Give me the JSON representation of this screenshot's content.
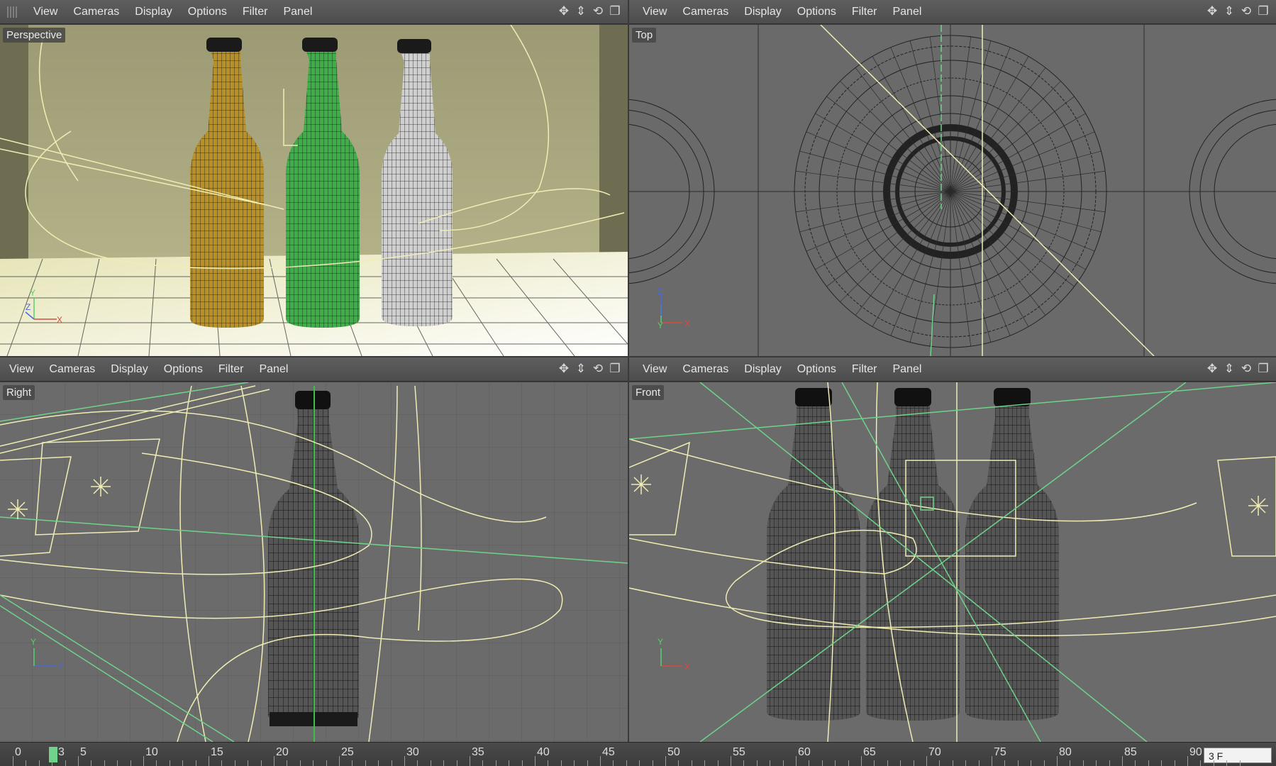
{
  "menu": [
    "View",
    "Cameras",
    "Display",
    "Options",
    "Filter",
    "Panel"
  ],
  "viewports": {
    "perspective": {
      "label": "Perspective"
    },
    "top": {
      "label": "Top"
    },
    "right": {
      "label": "Right"
    },
    "front": {
      "label": "Front"
    }
  },
  "nav_icons": [
    "move-view-icon",
    "zoom-view-icon",
    "rotate-view-icon",
    "maximize-view-icon"
  ],
  "axis": {
    "x": "X",
    "y": "Y",
    "z": "Z"
  },
  "timeline": {
    "ticks": [
      "0",
      "5",
      "10",
      "15",
      "20",
      "25",
      "30",
      "35",
      "40",
      "45",
      "50",
      "55",
      "60",
      "65",
      "70",
      "75",
      "80",
      "85",
      "90"
    ],
    "current_frame": "3",
    "frame_field": "3 F"
  },
  "colors": {
    "spline": "#e8e6a8",
    "green_axis": "#6fd38a",
    "bottle_amber": "#b8902a",
    "bottle_green": "#3fae4a",
    "bottle_clear": "#cfcfcf",
    "wire": "#1c1c1c"
  }
}
